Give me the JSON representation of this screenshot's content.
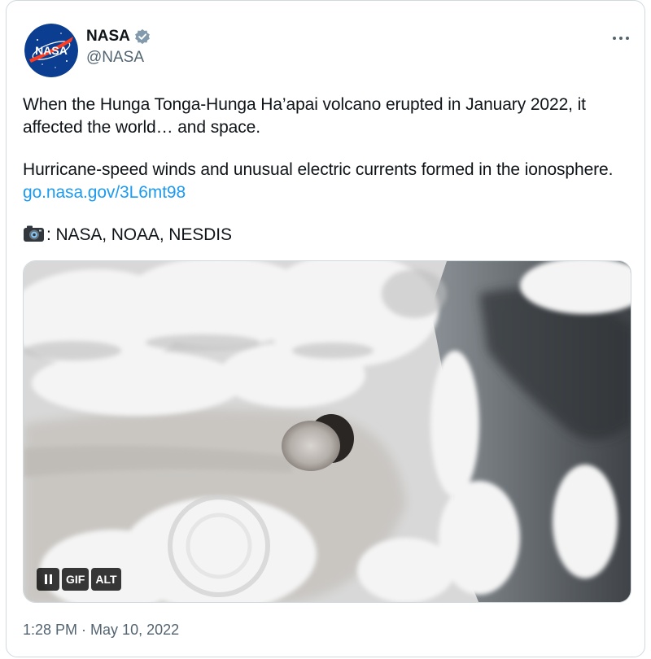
{
  "author": {
    "display_name": "NASA",
    "handle": "@NASA",
    "verified": true,
    "logo_text": "NASA"
  },
  "tweet": {
    "paragraph1": "When the Hunga Tonga-Hunga Ha’apai volcano erupted in January 2022, it affected the world… and space.",
    "paragraph2_text": "Hurricane-speed winds and unusual electric currents formed in the ionosphere.",
    "paragraph2_link": "go.nasa.gov/3L6mt98",
    "credit_text": ": NASA, NOAA, NESDIS"
  },
  "media": {
    "type": "gif",
    "gif_label": "GIF",
    "alt_label": "ALT"
  },
  "meta": {
    "time": "1:28 PM",
    "separator": " · ",
    "date": "May 10, 2022"
  },
  "colors": {
    "link": "#1d9bf0",
    "verified_badge": "#829aab",
    "nasa_blue": "#0b3d91",
    "nasa_red": "#fc3d21"
  }
}
